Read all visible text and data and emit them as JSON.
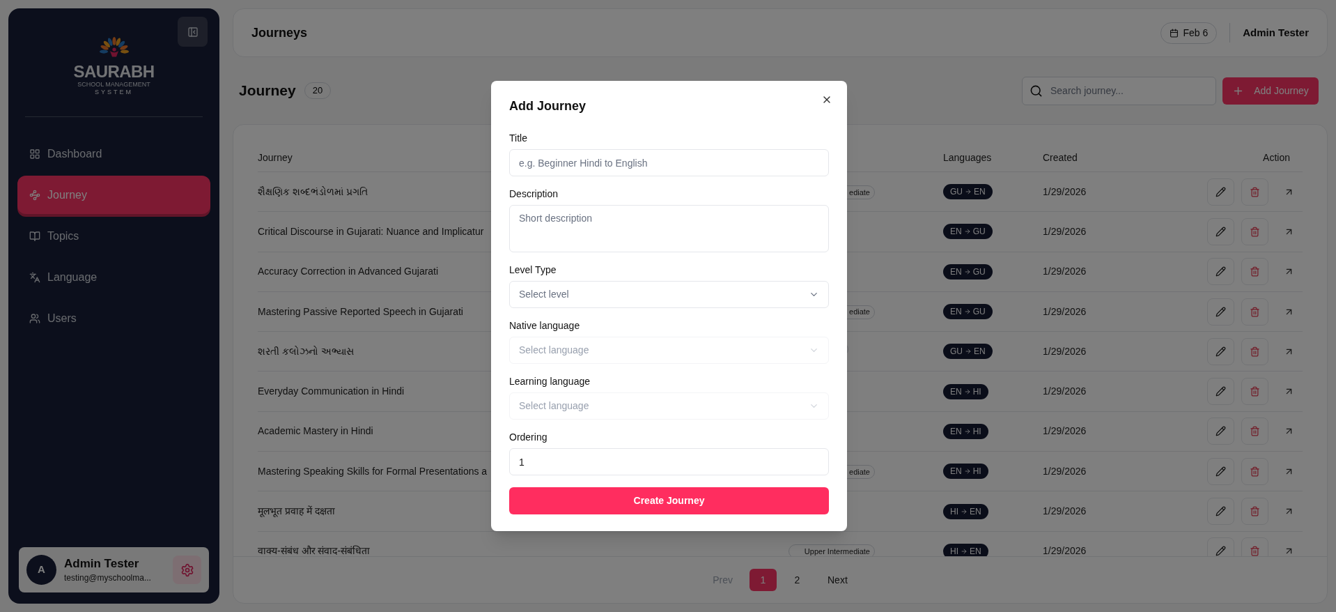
{
  "sidebar": {
    "logo": {
      "name": "SAURABH",
      "line1": "SCHOOL MANAGEMENT",
      "line2": "SYSTEM"
    },
    "items": [
      {
        "label": "Dashboard",
        "selected": false
      },
      {
        "label": "Journey",
        "selected": true
      },
      {
        "label": "Topics",
        "selected": false
      },
      {
        "label": "Language",
        "selected": false
      },
      {
        "label": "Users",
        "selected": false
      }
    ],
    "profile": {
      "avatar": "A",
      "name": "Admin Tester",
      "email": "testing@myschoolma..."
    }
  },
  "header": {
    "title": "Journeys",
    "date": "Feb 6",
    "user": "Admin Tester"
  },
  "page": {
    "title": "Journey",
    "count": "20",
    "search": {
      "placeholder": "Search journey..."
    },
    "add_button": "Add Journey"
  },
  "table": {
    "columns": [
      "Journey",
      "Languages",
      "Created",
      "Action"
    ],
    "rows": [
      {
        "journey": "શૈક્ષણિક શબ્દભંડોળમાં પ્રગતિ",
        "level_badge": true,
        "level": "ediate",
        "from": "GU",
        "to": "EN",
        "created": "1/29/2026"
      },
      {
        "journey": "Critical Discourse in Gujarati: Nuance and Implicatur",
        "level_badge": false,
        "from": "EN",
        "to": "GU",
        "created": "1/29/2026"
      },
      {
        "journey": "Accuracy Correction in Advanced Gujarati",
        "level_badge": false,
        "from": "EN",
        "to": "GU",
        "created": "1/29/2026"
      },
      {
        "journey": "Mastering Passive Reported Speech in Gujarati",
        "level_badge": true,
        "level": "ediate",
        "from": "EN",
        "to": "GU",
        "created": "1/29/2026"
      },
      {
        "journey": "શરતી કલોઝનો અભ્યાસ",
        "level_badge": true,
        "from": "GU",
        "to": "EN",
        "created": "1/29/2026"
      },
      {
        "journey": "Everyday Communication in Hindi",
        "level_badge": false,
        "from": "EN",
        "to": "HI",
        "created": "1/29/2026"
      },
      {
        "journey": "Academic Mastery in Hindi",
        "level_badge": false,
        "from": "EN",
        "to": "HI",
        "created": "1/29/2026"
      },
      {
        "journey": "Mastering Speaking Skills for Formal Presentations a",
        "level_badge": true,
        "level": "ediate",
        "from": "EN",
        "to": "HI",
        "created": "1/29/2026"
      },
      {
        "journey": "मूलभूत प्रवाह में दक्षता",
        "level_badge": false,
        "from": "HI",
        "to": "EN",
        "created": "1/29/2026"
      },
      {
        "journey": "वाक्य-संबंध और संवाद-संबंधिता",
        "level_badge": true,
        "level": "Upper Intermediate",
        "from": "HI",
        "to": "EN",
        "created": "1/29/2026"
      }
    ]
  },
  "pagination": {
    "prev": "Prev",
    "pages": [
      {
        "label": "1",
        "selected": true
      },
      {
        "label": "2",
        "selected": false
      }
    ],
    "next": "Next"
  },
  "modal": {
    "title": "Add Journey",
    "fields": [
      {
        "label": "Title",
        "kind": "text",
        "placeholder": "e.g. Beginner Hindi to English",
        "disabled": false
      },
      {
        "label": "Description",
        "kind": "textarea",
        "placeholder": "Short description",
        "disabled": false
      },
      {
        "label": "Level Type",
        "kind": "select",
        "placeholder": "Select level",
        "disabled": false
      },
      {
        "label": "Native language",
        "kind": "select",
        "placeholder": "Select language",
        "disabled": true
      },
      {
        "label": "Learning language",
        "kind": "select",
        "placeholder": "Select language",
        "disabled": true
      },
      {
        "label": "Ordering",
        "kind": "number",
        "value": "1",
        "disabled": false
      }
    ],
    "submit": "Create Journey"
  }
}
